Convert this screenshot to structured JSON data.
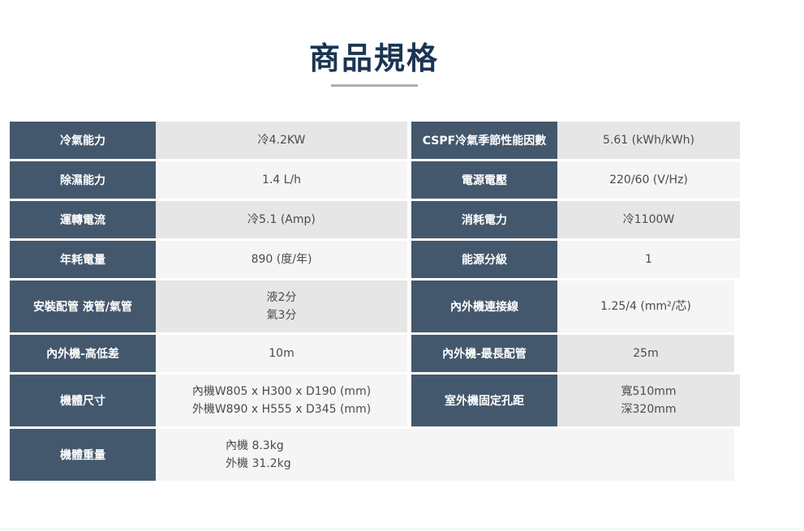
{
  "title": "商品規格",
  "specs": [
    {
      "left_label": "冷氣能力",
      "left_value": [
        "冷4.2KW"
      ],
      "right_label": "CSPF冷氣季節性能因數",
      "right_value": [
        "5.61 (kWh/kWh)"
      ]
    },
    {
      "left_label": "除濕能力",
      "left_value": [
        "1.4 L/h"
      ],
      "right_label": "電源電壓",
      "right_value": [
        "220/60 (V/Hz)"
      ]
    },
    {
      "left_label": "運轉電流",
      "left_value": [
        "冷5.1 (Amp)"
      ],
      "right_label": "消耗電力",
      "right_value": [
        "冷1100W"
      ]
    },
    {
      "left_label": "年耗電量",
      "left_value": [
        "890 (度/年)"
      ],
      "right_label": "能源分級",
      "right_value": [
        "1"
      ]
    },
    {
      "left_label": "安裝配管 液管/氣管",
      "left_value": [
        "液2分",
        "氣3分"
      ],
      "right_label": "內外機連接線",
      "right_value": [
        "1.25/4 (mm²/芯)"
      ]
    },
    {
      "left_label": "內外機-高低差",
      "left_value": [
        "10m"
      ],
      "right_label": "內外機-最長配管",
      "right_value": [
        "25m"
      ]
    },
    {
      "left_label": "機體尺寸",
      "left_value": [
        "內機W805 x H300 x D190 (mm)",
        "外機W890 x H555 x D345 (mm)"
      ],
      "right_label": "室外機固定孔距",
      "right_value": [
        "寬510mm",
        "深320mm"
      ]
    }
  ],
  "weight": {
    "label": "機體重量",
    "value": [
      "內機 8.3kg",
      "外機 31.2kg"
    ]
  }
}
